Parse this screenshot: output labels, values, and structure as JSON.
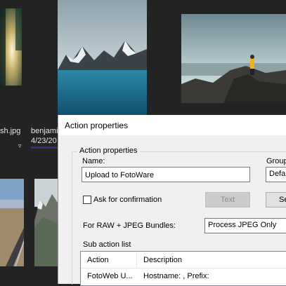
{
  "browser": {
    "files": [
      {
        "name_fragment": "sh.jpg"
      },
      {
        "name_fragment": "benjami",
        "date_fragment": "4/23/20"
      }
    ],
    "thumbnail_subjects": [
      "sunlit-forest",
      "snowy-mountain-lake",
      "hiker-on-coastal-cliff",
      "desert-road",
      "mountain-valley"
    ]
  },
  "dialog": {
    "title": "Action properties",
    "group_label": "Action properties",
    "name_label": "Name:",
    "name_value": "Upload to FotoWare",
    "group_label_right": "Group",
    "group_value": "Defa",
    "ask_confirmation_label": "Ask for confirmation",
    "ask_confirmation_checked": false,
    "text_button": "Text",
    "se_button": "Se",
    "raw_jpeg_label": "For RAW + JPEG Bundles:",
    "raw_jpeg_value": "Process JPEG Only",
    "sub_action_label": "Sub action list",
    "sub_action_columns": [
      "Action",
      "Description"
    ],
    "sub_action_rows": [
      {
        "action": "FotoWeb U...",
        "description": "Hostname: , Prefix:"
      }
    ]
  },
  "colors": {
    "browser_bg": "#232323",
    "dialog_bg": "#f0f0f0",
    "selection": "#3a2f7a"
  }
}
